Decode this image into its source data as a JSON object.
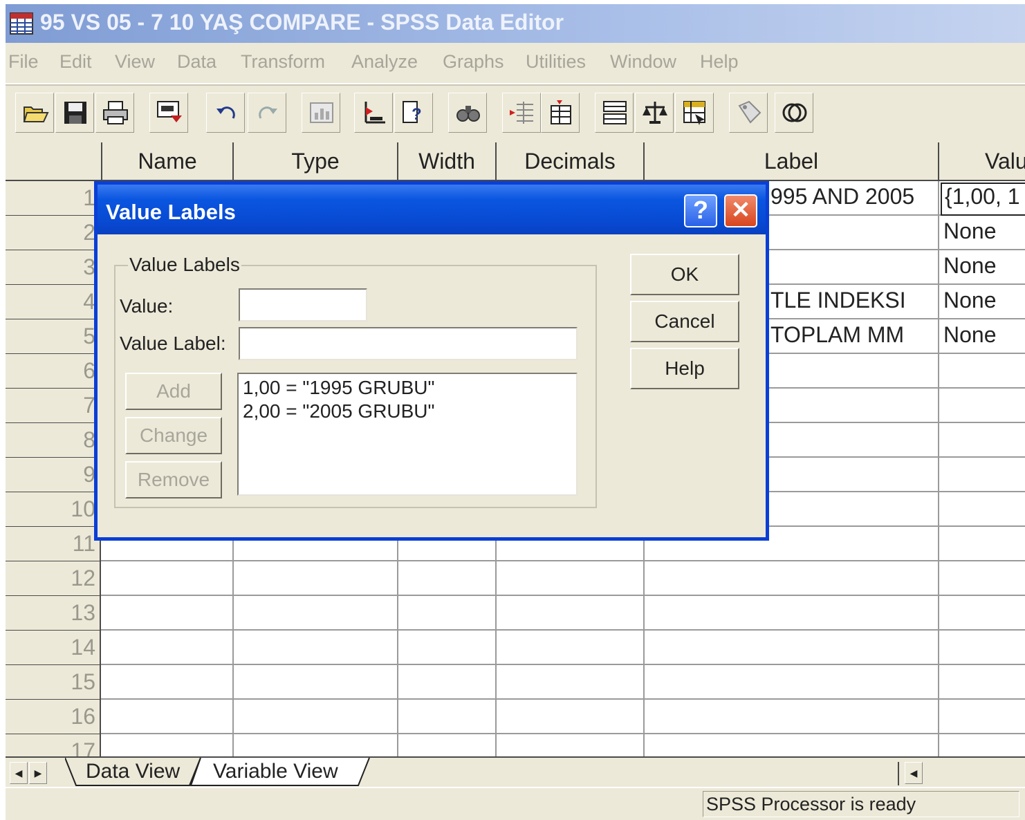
{
  "window": {
    "title": "95 VS 05 - 7 10 YAŞ COMPARE - SPSS Data Editor"
  },
  "menu": [
    "File",
    "Edit",
    "View",
    "Data",
    "Transform",
    "Analyze",
    "Graphs",
    "Utilities",
    "Window",
    "Help"
  ],
  "toolbar_icons": [
    "open-icon",
    "save-icon",
    "print-icon",
    "dialog-recall-icon",
    "undo-icon",
    "redo-icon",
    "chart-icon",
    "goto-case-icon",
    "variables-icon",
    "find-icon",
    "insert-cases-icon",
    "insert-variable-icon",
    "split-file-icon",
    "weight-cases-icon",
    "select-cases-icon",
    "value-labels-icon",
    "use-sets-icon"
  ],
  "grid": {
    "columns": [
      "Name",
      "Type",
      "Width",
      "Decimals",
      "Label",
      "Valu"
    ],
    "rows": [
      "1",
      "2",
      "3",
      "4",
      "5",
      "6",
      "7",
      "8",
      "9",
      "10",
      "11",
      "12",
      "13",
      "14",
      "15",
      "16",
      "17"
    ],
    "visible_cells": {
      "label_row1": "995 AND 2005",
      "label_row4": "TLE INDEKSI",
      "label_row5": "TOPLAM MM",
      "values": [
        "{1,00, 1",
        "None",
        "None",
        "None",
        "None"
      ]
    }
  },
  "tabs": {
    "data_view": "Data View",
    "variable_view": "Variable View"
  },
  "status": {
    "text": "SPSS Processor  is ready"
  },
  "dialog": {
    "title": "Value Labels",
    "group_label": "Value Labels",
    "value_label": "Value:",
    "value_input": "",
    "value_label_label": "Value Label:",
    "value_label_input": "",
    "buttons": {
      "add": "Add",
      "change": "Change",
      "remove": "Remove",
      "ok": "OK",
      "cancel": "Cancel",
      "help": "Help"
    },
    "list_items": [
      "1,00 = \"1995 GRUBU\"",
      "2,00 = \"2005 GRUBU\""
    ]
  },
  "colors": {
    "titlebar": "#8fa8dc",
    "dialog_title": "#0a56e0",
    "chrome": "#ece9d8",
    "close_button": "#d8451f"
  }
}
